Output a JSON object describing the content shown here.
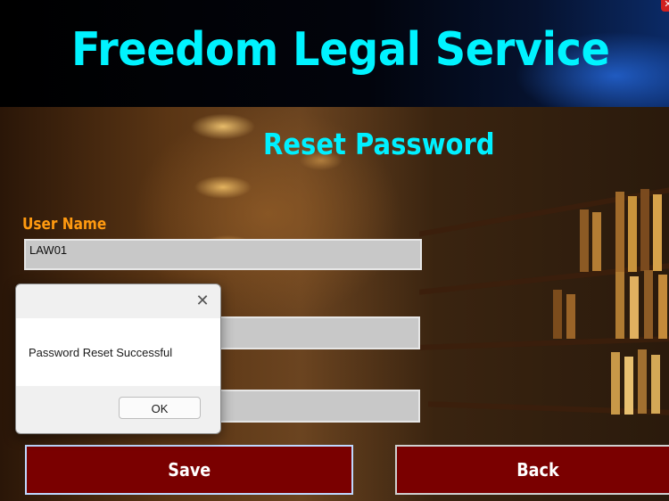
{
  "window": {
    "title": "Freedom Legal Service",
    "close_glyph": "✕"
  },
  "form": {
    "heading": "Reset Password",
    "username_label": "User Name",
    "username_value": "LAW01",
    "new_password_value": "",
    "confirm_password_value": ""
  },
  "buttons": {
    "save_label": "Save",
    "back_label": "Back"
  },
  "dialog": {
    "message": "Password Reset Successful",
    "ok_label": "OK",
    "close_glyph": "✕"
  },
  "colors": {
    "title": "#00f3ff",
    "label": "#ff9a10",
    "button_bg": "#7a0000"
  }
}
